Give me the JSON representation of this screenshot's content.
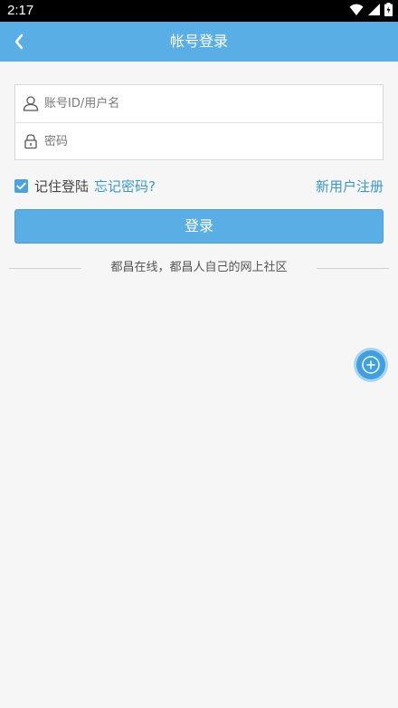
{
  "status_bar": {
    "time": "2:17",
    "icons": [
      "wifi-icon",
      "signal-icon",
      "battery-icon"
    ]
  },
  "app_bar": {
    "title": "帐号登录",
    "back_icon": "chevron-left-icon"
  },
  "form": {
    "account_placeholder": "账号ID/用户名",
    "account_icon": "user-icon",
    "password_placeholder": "密码",
    "password_icon": "lock-icon"
  },
  "options": {
    "remember_label": "记住登陆",
    "remember_checked": true,
    "forgot_link": "忘记密码?",
    "register_link": "新用户注册"
  },
  "login_button": "登录",
  "slogan": "都昌在线，都昌人自己的网上社区",
  "floating_button_icon": "plus-icon",
  "colors": {
    "accent": "#5aaee6",
    "link": "#3a97d6",
    "background": "#f6f6f6"
  }
}
